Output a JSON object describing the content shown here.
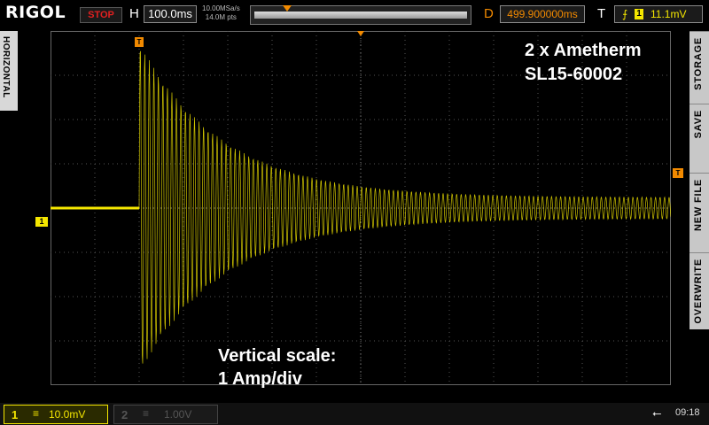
{
  "header": {
    "brand": "RIGOL",
    "run_status": "STOP",
    "timebase_label": "H",
    "timebase_value": "100.0ms",
    "sample_rate": "10.00MSa/s",
    "memory_depth": "14.0M pts",
    "delay_label": "D",
    "delay_value": "499.900000ms",
    "trigger_label": "T",
    "trigger_channel": "1",
    "trigger_level": "11.1mV"
  },
  "side_tabs": {
    "left": "HORIZONTAL",
    "right": [
      "STORAGE",
      "SAVE",
      "NEW FILE",
      "OVERWRITE"
    ]
  },
  "annotations": {
    "title_line1": "2 x Ametherm",
    "title_line2": "SL15-60002",
    "scale_line1": "Vertical scale:",
    "scale_line2": "1 Amp/div"
  },
  "markers": {
    "ch1": "1",
    "trigger_level": "T",
    "trigger_position": "T"
  },
  "footer": {
    "ch1_number": "1",
    "ch1_coupling": "≡",
    "ch1_scale": "10.0mV",
    "ch2_number": "2",
    "ch2_coupling": "≡",
    "ch2_scale": "1.00V",
    "usb_icon": "usb-icon",
    "time": "09:18"
  },
  "colors": {
    "ch1": "#f5e700",
    "trigger": "#f28a00",
    "stop": "#e02020"
  }
}
